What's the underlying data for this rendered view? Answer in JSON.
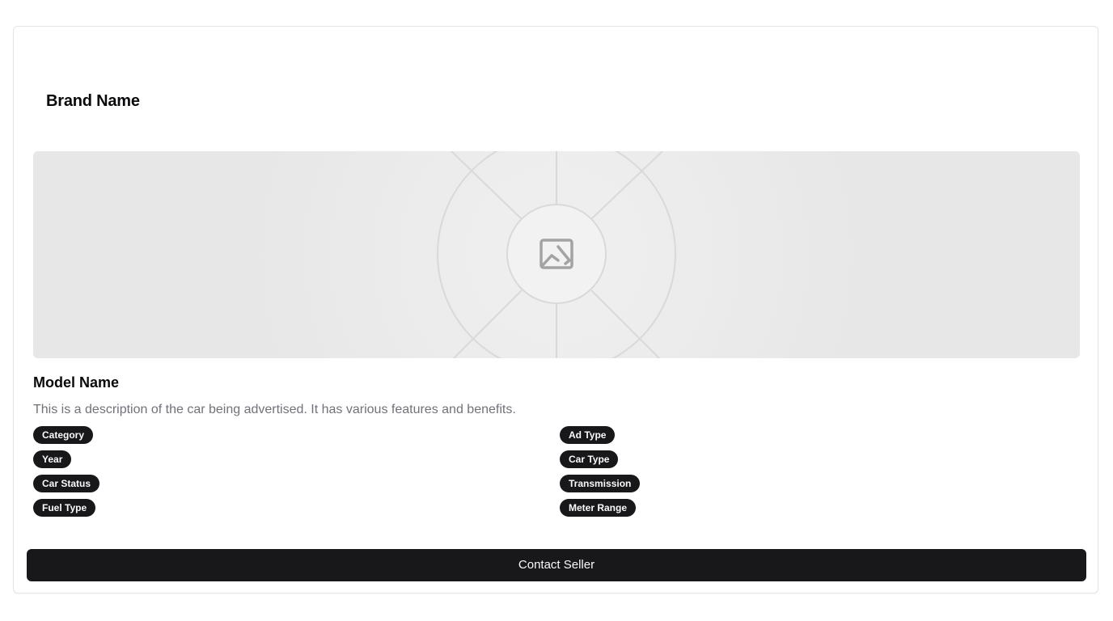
{
  "card": {
    "brand_name": "Brand Name",
    "image": {
      "icon": "image-placeholder-icon"
    },
    "model_name": "Model Name",
    "description": "This is a description of the car being advertised. It has various features and benefits.",
    "tags_left": [
      "Category",
      "Year",
      "Car Status",
      "Fuel Type"
    ],
    "tags_right": [
      "Ad Type",
      "Car Type",
      "Transmission",
      "Meter Range"
    ],
    "contact_label": "Contact Seller"
  },
  "colors": {
    "primary": "#18181b",
    "muted_text": "#71717a",
    "placeholder_bg": "#e7e7e7",
    "border": "#e4e4e7"
  }
}
